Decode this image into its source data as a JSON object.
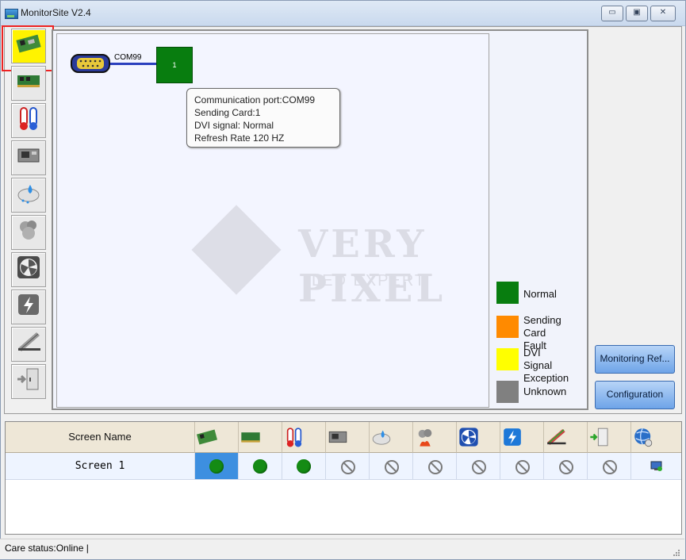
{
  "window": {
    "title": "MonitorSite V2.4",
    "minimize": "▭",
    "maximize": "▣",
    "close": "✕"
  },
  "sidebar_icons": [
    "receiving-card-icon",
    "sending-card-icon",
    "temperature-icon",
    "hub-card-icon",
    "humidity-icon",
    "smoke-icon",
    "fan-icon",
    "power-icon",
    "ribbon-cable-icon",
    "cabinet-door-icon"
  ],
  "topology": {
    "port_label": "COM99",
    "card_number": "1",
    "tooltip": [
      "Communication port:COM99",
      "Sending Card:1",
      "DVI signal: Normal",
      "Refresh Rate 120 HZ"
    ]
  },
  "watermark": {
    "text": "VERY PIXEL",
    "sub": "LED EXPERT"
  },
  "legend": [
    {
      "label": "Normal",
      "color": "#087d0f"
    },
    {
      "label": "Sending\nCard Fault",
      "color": "#ff8a00"
    },
    {
      "label": "DVI Signal\nException",
      "color": "#ffff00"
    },
    {
      "label": "Unknown",
      "color": "#808080"
    }
  ],
  "buttons": {
    "monitoring_refresh": "Monitoring Ref...",
    "configuration": "Configuration"
  },
  "grid": {
    "header_name": "Screen Name",
    "rows": [
      {
        "name": "Screen  1",
        "states": [
          "ok",
          "ok",
          "ok",
          "none",
          "none",
          "none",
          "none",
          "none",
          "none",
          "none",
          "display"
        ]
      }
    ]
  },
  "status_bar": "Care status:Online  |"
}
